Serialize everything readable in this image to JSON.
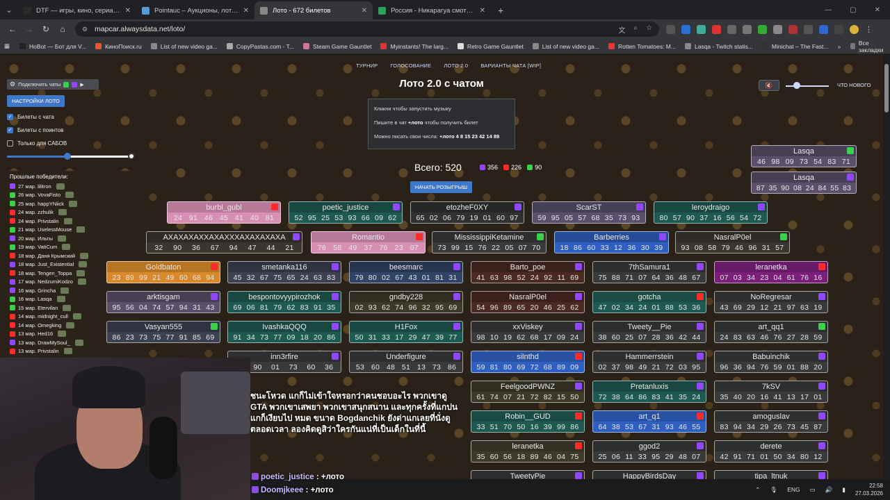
{
  "browser": {
    "tabs": [
      {
        "title": "DTF — игры, кино, сериалы, р",
        "color": "#2a2a2a"
      },
      {
        "title": "Pointauc – Аукционы, лотерея",
        "color": "#5b9bd5"
      },
      {
        "title": "Лото - 672 билетов",
        "color": "#888888",
        "active": true
      },
      {
        "title": "Россия - Никарагуа смотреть",
        "color": "#2e9e5b"
      }
    ],
    "url": "mapcar.alwaysdata.net/loto/",
    "bookmarks": [
      {
        "label": "HoBot — Бот для V...",
        "color": "#222"
      },
      {
        "label": "КиноПоиск.ru",
        "color": "#e8562a"
      },
      {
        "label": "List of new video ga...",
        "color": "#888"
      },
      {
        "label": "CopyPastas.com - T...",
        "color": "#aaa"
      },
      {
        "label": "Steam Game Gauntlet",
        "color": "#c79"
      },
      {
        "label": "Myinstants! The larg...",
        "color": "#d33"
      },
      {
        "label": "Retro Game Gauntlet",
        "color": "#ddd"
      },
      {
        "label": "List of new video ga...",
        "color": "#888"
      },
      {
        "label": "Rotten Tomatoes: M...",
        "color": "#e33"
      },
      {
        "label": "Lasqa - Twitch statis...",
        "color": "#888"
      },
      {
        "label": "Minichat – The Fast...",
        "color": "#333"
      }
    ],
    "all_bookmarks": "Все закладки"
  },
  "topnav": [
    "ТУРНИР",
    "ГОЛОСОВАНИЕ",
    "ЛОТО 2.0",
    "ВАРИАНТЫ ЧАТА [WIP]"
  ],
  "heading": "Лото 2.0 с чатом",
  "whats_new": "ЧТО НОВОГО",
  "info": {
    "line1": "Кликни чтобы запустить музыку",
    "line2_pre": "Пишите в чат ",
    "line2_cmd": "+лото",
    "line2_post": " чтобы получить билет",
    "line3_pre": "Можно писать свои числа: ",
    "line3_cmd": "+лото 4 8 15 23 42 14 89"
  },
  "left": {
    "connect": "Подключить чаты",
    "settings": "НАСТРОЙКИ ЛОТО",
    "chk1": "Билеты с чата",
    "chk2": "Билеты с поинтов",
    "chk3": "Только для САБОВ",
    "winners_title": "Прошлые победители:",
    "winners": [
      {
        "d": "27 мар. lilitron",
        "p": "tw"
      },
      {
        "d": "26 мар. VovaFisto",
        "p": "kk"
      },
      {
        "d": "25 мар. happYNiick",
        "p": "kk"
      },
      {
        "d": "24 мар. zzhulik",
        "p": "yt"
      },
      {
        "d": "24 мар. Privstalin",
        "p": "yt"
      },
      {
        "d": "21 мар. UselessMouse",
        "p": "kk"
      },
      {
        "d": "20 мар. Ильты",
        "p": "tw"
      },
      {
        "d": "19 мар. VatiCum",
        "p": "kk"
      },
      {
        "d": "18 мар. Даня Крымский",
        "p": "yt"
      },
      {
        "d": "18 мар. Just_Existential",
        "p": "tw"
      },
      {
        "d": "18 мар. Tengen_Toppa",
        "p": "yt"
      },
      {
        "d": "17 мар. NedzumiKodzo",
        "p": "tw"
      },
      {
        "d": "16 мар. Grincha",
        "p": "tw"
      },
      {
        "d": "16 мар. Lasqa",
        "p": "kk"
      },
      {
        "d": "15 мар. Etervilan",
        "p": "kk"
      },
      {
        "d": "14 мар. midnight_cull",
        "p": "yt"
      },
      {
        "d": "14 мар. Omegking",
        "p": "yt"
      },
      {
        "d": "13 мар. Hed16",
        "p": "yt"
      },
      {
        "d": "13 мар. DrawMySoul_",
        "p": "tw"
      },
      {
        "d": "13 мар. Privstalin",
        "p": "yt"
      }
    ]
  },
  "stats": {
    "total": "Всего: 520",
    "twitch": "356",
    "youtube": "226",
    "kick": "90",
    "draw": "НАЧАТЬ РОЗЫГРЫШ"
  },
  "colors": {
    "twitch": "#9146ff",
    "youtube": "#ff2a2a",
    "kick": "#3ad14b",
    "accent": "#3f78c8"
  },
  "tickets": [
    {
      "n": "Lasqa",
      "v": "46 98 09 73 54 83 71",
      "p": "kk",
      "bg": "#5b4f6a"
    },
    {
      "n": "Lasqa",
      "v": "87 35 90 08 24 84 55 83",
      "p": "tw",
      "bg": "#5b4f6a"
    },
    {
      "n": "burbl_gubl",
      "v": "24 91 46 45 41 40 81",
      "p": "yt",
      "bg": "#d88fb5"
    },
    {
      "n": "poetic_justice",
      "v": "52 95 25 53 93 66 09 62",
      "p": "tw",
      "bg": "#1f5a52"
    },
    {
      "n": "etozheF0XY",
      "v": "65 02 06 79 19 01 60 97",
      "p": "tw",
      "bg": "#2f3230"
    },
    {
      "n": "ScarST",
      "v": "59 95 05 57 68 35 73 93",
      "p": "tw",
      "bg": "#58506c"
    },
    {
      "n": "leroydraigo",
      "v": "80 57 90 37 16 56 54 72",
      "p": "tw",
      "bg": "#1f5a52"
    },
    {
      "n": "AXAXAXAXXAXAXXXAXAXAXAXA",
      "v": "32 90 36 67 94 47 44 21",
      "p": "tw",
      "bg": "#3a3530"
    },
    {
      "n": "Romantio",
      "v": "76 58 49 37 76 23 07",
      "p": "yt",
      "bg": "#d88fb5"
    },
    {
      "n": "MississippiKetamine",
      "v": "73 99 15 76 22 05 07 70",
      "p": "kk",
      "bg": "#3a3a3a"
    },
    {
      "n": "Barberries",
      "v": "18 86 60 33 12 36 30 39",
      "p": "tw",
      "bg": "#2f5fc0"
    },
    {
      "n": "NasralP0el",
      "v": "93 08 58 79 46 96 31 57",
      "p": "kk",
      "bg": "#3a3530"
    },
    {
      "n": "Goldbaton",
      "v": "23 89 99 21 49 60 68 94",
      "p": "yt",
      "bg": "#d8892a"
    },
    {
      "n": "smetanka116",
      "v": "45 32 67 75 65 24 63 83",
      "p": "tw",
      "bg": "#3d4250"
    },
    {
      "n": "beesmarc",
      "v": "79 80 02 67 43 01 81 31",
      "p": "tw",
      "bg": "#2f4466"
    },
    {
      "n": "Barto_poe",
      "v": "41 63 98 52 24 92 11 69",
      "p": "tw",
      "bg": "#4a2a22"
    },
    {
      "n": "7thSamura1",
      "v": "75 88 71 07 64 36 48 67",
      "p": "tw",
      "bg": "#3a3a3a"
    },
    {
      "n": "leranetka",
      "v": "07 03 34 23 04 61 76 16",
      "p": "yt",
      "bg": "#7a1f7a"
    },
    {
      "n": "arktisgam",
      "v": "95 56 04 74 57 94 31 43",
      "p": "tw",
      "bg": "#5b4f6a"
    },
    {
      "n": "bespontovyypirozhok",
      "v": "69 06 81 79 62 83 91 35",
      "p": "tw",
      "bg": "#1f5a52"
    },
    {
      "n": "gndby228",
      "v": "02 93 62 74 96 32 95 69",
      "p": "tw",
      "bg": "#3d3a2a"
    },
    {
      "n": "NasralP0el",
      "v": "54 96 89 65 20 46 25 62",
      "p": "tw",
      "bg": "#4a2a22"
    },
    {
      "n": "gotcha",
      "v": "47 02 34 24 01 88 53 36",
      "p": "yt",
      "bg": "#1f5a52"
    },
    {
      "n": "NoRegresar",
      "v": "43 69 29 12 21 97 63 19",
      "p": "tw",
      "bg": "#3a3a3a"
    },
    {
      "n": "Vasyan555",
      "v": "86 23 73 75 77 91 85 69",
      "p": "kk",
      "bg": "#3d4250"
    },
    {
      "n": "IvashkaQQQ",
      "v": "91 34 73 77 09 18 20 86",
      "p": "tw",
      "bg": "#1f5a52"
    },
    {
      "n": "H1Fox",
      "v": "50 31 33 17 29 47 39 77",
      "p": "tw",
      "bg": "#1f5a52"
    },
    {
      "n": "xxViskey",
      "v": "98 10 19 62 68 17 09 24",
      "p": "tw",
      "bg": "#3a3a3a"
    },
    {
      "n": "Tweety__Pie",
      "v": "38 60 25 07 28 36 42 44",
      "p": "tw",
      "bg": "#3a3a3a"
    },
    {
      "n": "art_qq1",
      "v": "24 83 63 46 76 27 28 59",
      "p": "kk",
      "bg": "#3a3a3a"
    },
    {
      "n": "inn3rfire",
      "v": "71 90 01 73 60 36",
      "p": "tw",
      "bg": "#3a3a3a"
    },
    {
      "n": "Underfigure",
      "v": "53 60 48 51 13 73 86",
      "p": "tw",
      "bg": "#3a3a3a"
    },
    {
      "n": "silnthd",
      "v": "59 81 80 69 72 68 89 09",
      "p": "yt",
      "bg": "#2f5fc0"
    },
    {
      "n": "Hammerrstein",
      "v": "02 37 98 49 21 72 03 95",
      "p": "tw",
      "bg": "#3a3a3a"
    },
    {
      "n": "Babuinchik",
      "v": "96 36 94 76 59 01 88 20",
      "p": "tw",
      "bg": "#3a3a3a"
    },
    {
      "n": "FeelgoodPWNZ",
      "v": "61 74 07 21 72 82 15 50",
      "p": "tw",
      "bg": "#3d3a2a"
    },
    {
      "n": "Pretanluxis",
      "v": "72 38 64 86 83 41 35 24",
      "p": "tw",
      "bg": "#1f5a52"
    },
    {
      "n": "7kSV",
      "v": "35 40 20 16 41 13 17 01",
      "p": "tw",
      "bg": "#3a3a3a"
    },
    {
      "n": "Robin__GUD",
      "v": "33 51 70 50 16 39 99 86",
      "p": "yt",
      "bg": "#1f5a52"
    },
    {
      "n": "art_q1",
      "v": "64 38 53 67 31 93 46 55",
      "p": "yt",
      "bg": "#2f5fc0"
    },
    {
      "n": "amoguslav",
      "v": "83 94 34 29 26 73 45 87",
      "p": "tw",
      "bg": "#3a3a3a"
    },
    {
      "n": "leranetka",
      "v": "35 60 56 18 89 46 04 75",
      "p": "yt",
      "bg": "#3d3a2a"
    },
    {
      "n": "ggod2",
      "v": "25 06 11 33 95 29 48 07",
      "p": "tw",
      "bg": "#3a3a3a"
    },
    {
      "n": "derete",
      "v": "42 91 71 01 50 34 80 12",
      "p": "tw",
      "bg": "#3a3a3a"
    },
    {
      "n": "TweetyPie",
      "v": "",
      "p": "tw",
      "bg": "#3a3a3a"
    },
    {
      "n": "HappyBirdsDay",
      "v": "",
      "p": "tw",
      "bg": "#3a3a3a"
    },
    {
      "n": "tipa_ltnuk",
      "v": "",
      "p": "tw",
      "bg": "#3a3a3a"
    }
  ],
  "overlay_text": "ชนะโหวด แกก็ไม่เข้าใจหรอกว่าคนชอบอะไร พวกเขาดู GTA พวกเขาเสพยา พวกเขาสนุกสนาน และทุกครั้งที่แกปน แกก็เงียบไป หมด ขนาด Bogdanchik ยังด่าแกเลยที่นั่งดูตลอดเวลา ลองคิดดูสิว่าใครกันแน่ที่เป็นเด็กในที่นี้",
  "chat": [
    {
      "user": "poetic_justice",
      "msg": " : +лото"
    },
    {
      "user": "Doomjkeee",
      "msg": " : +лото"
    }
  ],
  "taskbar": {
    "lang": "ENG",
    "time": "22:58",
    "date": "27.03.2026"
  }
}
